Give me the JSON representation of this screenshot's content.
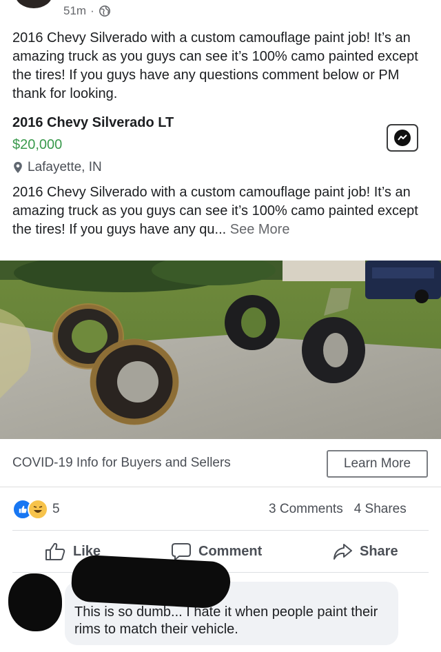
{
  "post": {
    "time": "51m",
    "separator": "·",
    "text": "2016 Chevy Silverado with a custom camouflage paint job! It’s an amazing truck as you guys can see it’s 100% camo painted except the tires! If you guys have any questions comment below or PM thank for looking."
  },
  "listing": {
    "title": "2016 Chevy Silverado LT",
    "price": "$20,000",
    "location": "Lafayette, IN",
    "description": "2016 Chevy Silverado with a custom camouflage paint job! It’s an amazing truck as you guys can see it’s 100% camo painted except the tires! If you guys have any qu...",
    "see_more": "See More"
  },
  "banner": {
    "text": "COVID-19 Info for Buyers and Sellers",
    "button": "Learn More"
  },
  "engagement": {
    "reaction_count": "5",
    "comments": "3 Comments",
    "shares": "4 Shares"
  },
  "actions": {
    "like": "Like",
    "comment": "Comment",
    "share": "Share"
  },
  "comment": {
    "text": "This is so dumb... I hate it when people paint their rims to match their vehicle."
  },
  "colors": {
    "price": "#3a9a4d",
    "like_blue": "#1877f2",
    "haha_yellow": "#f7c34b"
  }
}
